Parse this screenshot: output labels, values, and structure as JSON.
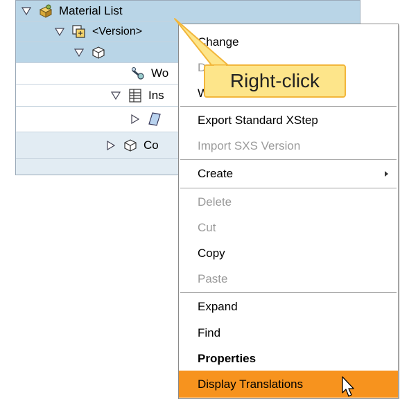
{
  "tree": {
    "rows": [
      {
        "label": "Material List",
        "icon": "material-list-icon"
      },
      {
        "label": "<Version>",
        "icon": "version-icon"
      },
      {
        "label": "",
        "icon": "cube-outline-icon"
      },
      {
        "label": "Wo",
        "icon": "work-center-icon"
      },
      {
        "label": "Ins",
        "icon": "table-icon"
      },
      {
        "label": "",
        "icon": "sheet-icon"
      },
      {
        "label": "Co",
        "icon": "component-icon"
      }
    ]
  },
  "menu": {
    "items": [
      {
        "label": "Change",
        "enabled": true
      },
      {
        "label": "D",
        "enabled": false
      },
      {
        "label": "W",
        "enabled": true
      },
      {
        "label": "Export Standard XStep",
        "enabled": true
      },
      {
        "label": "Import SXS Version",
        "enabled": false
      },
      {
        "label": "Create",
        "enabled": true,
        "submenu": true
      },
      {
        "label": "Delete",
        "enabled": false
      },
      {
        "label": "Cut",
        "enabled": false
      },
      {
        "label": "Copy",
        "enabled": true
      },
      {
        "label": "Paste",
        "enabled": false
      },
      {
        "label": "Expand",
        "enabled": true
      },
      {
        "label": "Find",
        "enabled": true
      },
      {
        "label": "Properties",
        "enabled": true,
        "bold": true
      },
      {
        "label": "Display Translations",
        "enabled": true,
        "highlighted": true
      }
    ]
  },
  "callout": {
    "text": "Right-click"
  },
  "colors": {
    "highlight": "#f7931e",
    "callout_fill": "#fde58a",
    "callout_border": "#f2b63b",
    "tree_bg": "#e2ecf3",
    "tree_selected": "#b9d5e7"
  }
}
